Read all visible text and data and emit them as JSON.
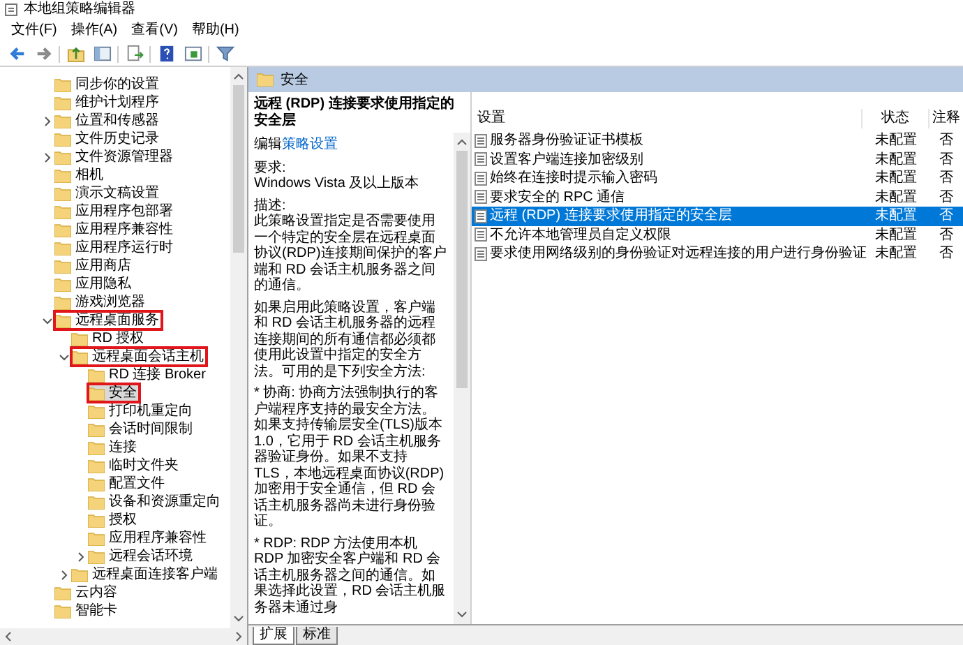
{
  "window": {
    "title": "本地组策略编辑器"
  },
  "menu": [
    "文件(F)",
    "操作(A)",
    "查看(V)",
    "帮助(H)"
  ],
  "tree": [
    {
      "label": "同步你的设置",
      "selected": false,
      "highlighted": false
    },
    {
      "label": "维护计划程序",
      "selected": false,
      "highlighted": false
    },
    {
      "label": "位置和传感器",
      "selected": false,
      "highlighted": false,
      "expanded": false
    },
    {
      "label": "文件历史记录",
      "selected": false,
      "highlighted": false
    },
    {
      "label": "文件资源管理器",
      "selected": false,
      "highlighted": false,
      "expanded": false
    },
    {
      "label": "相机",
      "selected": false,
      "highlighted": false
    },
    {
      "label": "演示文稿设置",
      "selected": false,
      "highlighted": false
    },
    {
      "label": "应用程序包部署",
      "selected": false,
      "highlighted": false
    },
    {
      "label": "应用程序兼容性",
      "selected": false,
      "highlighted": false
    },
    {
      "label": "应用程序运行时",
      "selected": false,
      "highlighted": false
    },
    {
      "label": "应用商店",
      "selected": false,
      "highlighted": false
    },
    {
      "label": "应用隐私",
      "selected": false,
      "highlighted": false
    },
    {
      "label": "游戏浏览器",
      "selected": false,
      "highlighted": false
    },
    {
      "label": "远程桌面服务",
      "selected": false,
      "highlighted": true,
      "expanded": true,
      "children": [
        {
          "label": "RD 授权",
          "selected": false,
          "highlighted": false
        },
        {
          "label": "远程桌面会话主机",
          "selected": false,
          "highlighted": true,
          "expanded": true,
          "children": [
            {
              "label": "RD 连接 Broker",
              "selected": false,
              "highlighted": false
            },
            {
              "label": "安全",
              "selected": true,
              "highlighted": true
            },
            {
              "label": "打印机重定向",
              "selected": false,
              "highlighted": false
            },
            {
              "label": "会话时间限制",
              "selected": false,
              "highlighted": false
            },
            {
              "label": "连接",
              "selected": false,
              "highlighted": false
            },
            {
              "label": "临时文件夹",
              "selected": false,
              "highlighted": false
            },
            {
              "label": "配置文件",
              "selected": false,
              "highlighted": false
            },
            {
              "label": "设备和资源重定向",
              "selected": false,
              "highlighted": false
            },
            {
              "label": "授权",
              "selected": false,
              "highlighted": false
            },
            {
              "label": "应用程序兼容性",
              "selected": false,
              "highlighted": false
            },
            {
              "label": "远程会话环境",
              "selected": false,
              "highlighted": false,
              "expanded": false
            }
          ]
        },
        {
          "label": "远程桌面连接客户端",
          "selected": false,
          "highlighted": false,
          "expanded": false
        }
      ]
    },
    {
      "label": "云内容",
      "selected": false,
      "highlighted": false
    },
    {
      "label": "智能卡",
      "selected": false,
      "highlighted": false
    }
  ],
  "header": {
    "title": "安全"
  },
  "description": {
    "title": "远程 (RDP) 连接要求使用指定的安全层",
    "edit_prefix": "编辑",
    "edit_link": "策略设置",
    "paragraphs": [
      "要求:",
      "Windows Vista 及以上版本",
      "描述:",
      "此策略设置指定是否需要使用一个特定的安全层在远程桌面协议(RDP)连接期间保护的客户端和 RD 会话主机服务器之间的通信。",
      "如果启用此策略设置，客户端和 RD 会话主机服务器的远程连接期间的所有通信都必须都使用此设置中指定的安全方法。可用的是下列安全方法:",
      "* 协商: 协商方法强制执行的客户端程序支持的最安全方法。如果支持传输层安全(TLS)版本 1.0，它用于 RD 会话主机服务器验证身份。如果不支持 TLS，本地远程桌面协议(RDP)加密用于安全通信，但 RD 会话主机服务器尚未进行身份验证。",
      "* RDP: RDP 方法使用本机 RDP 加密安全客户端和 RD 会话主机服务器之间的通信。如果选择此设置，RD 会话主机服务器未通过身"
    ]
  },
  "table": {
    "columns": [
      "设置",
      "状态",
      "注释"
    ],
    "rows": [
      {
        "name": "服务器身份验证证书模板",
        "state": "未配置",
        "note": "否",
        "selected": false
      },
      {
        "name": "设置客户端连接加密级别",
        "state": "未配置",
        "note": "否",
        "selected": false
      },
      {
        "name": "始终在连接时提示输入密码",
        "state": "未配置",
        "note": "否",
        "selected": false
      },
      {
        "name": "要求安全的 RPC 通信",
        "state": "未配置",
        "note": "否",
        "selected": false
      },
      {
        "name": "远程 (RDP) 连接要求使用指定的安全层",
        "state": "未配置",
        "note": "否",
        "selected": true
      },
      {
        "name": "不允许本地管理员自定义权限",
        "state": "未配置",
        "note": "否",
        "selected": false
      },
      {
        "name": "要求使用网络级别的身份验证对远程连接的用户进行身份验证",
        "state": "未配置",
        "note": "否",
        "selected": false
      }
    ]
  },
  "tabs": [
    {
      "label": "扩展",
      "selected": true
    },
    {
      "label": "标准",
      "selected": false
    }
  ]
}
